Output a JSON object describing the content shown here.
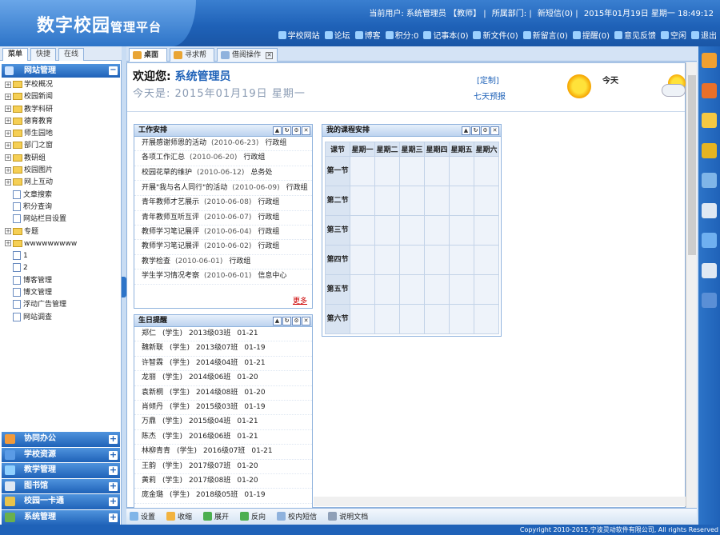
{
  "app": {
    "logo_main": "数字校园",
    "logo_sub": "管理平台"
  },
  "userline": {
    "current_user": "当前用户: 系统管理员 【教师】",
    "department": "所属部门:",
    "messages": "新短信(0)",
    "datetime": "2015年01月19日 星期一 18:49:12"
  },
  "toolbar": [
    {
      "label": "学校网站",
      "icon": "school-icon"
    },
    {
      "label": "论坛",
      "icon": "forum-icon"
    },
    {
      "label": "博客",
      "icon": "blog-icon"
    },
    {
      "label": "积分:0",
      "icon": "points-icon"
    },
    {
      "label": "记事本(0)",
      "icon": "notepad-icon"
    },
    {
      "label": "新文件(0)",
      "icon": "file-icon"
    },
    {
      "label": "新留言(0)",
      "icon": "message-icon"
    },
    {
      "label": "提醒(0)",
      "icon": "reminder-icon"
    },
    {
      "label": "意见反馈",
      "icon": "feedback-icon"
    },
    {
      "label": "空闲",
      "icon": "status-icon"
    },
    {
      "label": "退出",
      "icon": "exit-icon"
    }
  ],
  "left_tabs": [
    "菜单",
    "快捷",
    "在线"
  ],
  "nav": {
    "header": "网站管理",
    "tree": [
      {
        "label": "学校概况",
        "type": "folder"
      },
      {
        "label": "校园新闻",
        "type": "folder"
      },
      {
        "label": "教学科研",
        "type": "folder"
      },
      {
        "label": "德育教育",
        "type": "folder"
      },
      {
        "label": "师生园地",
        "type": "folder"
      },
      {
        "label": "部门之窗",
        "type": "folder"
      },
      {
        "label": "教研组",
        "type": "folder"
      },
      {
        "label": "校园图片",
        "type": "folder"
      },
      {
        "label": "网上互动",
        "type": "folder"
      },
      {
        "label": "文章搜索",
        "type": "page"
      },
      {
        "label": "积分查询",
        "type": "page"
      },
      {
        "label": "网站栏目设置",
        "type": "page"
      },
      {
        "label": "专题",
        "type": "folder"
      },
      {
        "label": "wwwwwwwww",
        "type": "folder"
      },
      {
        "label": "1",
        "type": "page"
      },
      {
        "label": "2",
        "type": "page"
      },
      {
        "label": "博客管理",
        "type": "page"
      },
      {
        "label": "博文管理",
        "type": "page"
      },
      {
        "label": "浮动广告管理",
        "type": "page"
      },
      {
        "label": "网站调查",
        "type": "page"
      }
    ],
    "sections": [
      "协同办公",
      "学校资源",
      "教学管理",
      "图书馆",
      "校园一卡通",
      "系统管理"
    ]
  },
  "tabs": [
    {
      "label": "桌面",
      "active": true
    },
    {
      "label": "寻求帮",
      "active": false
    },
    {
      "label": "借阅操作",
      "active": false
    }
  ],
  "welcome": {
    "greeting": "欢迎您:",
    "name": "系统管理员",
    "today": "今天是: 2015年01月19日 星期一",
    "customize": "[定制]",
    "forecast": "七天预报",
    "today_label": "今天"
  },
  "work_panel": {
    "title": "工作安排",
    "rows": [
      {
        "title": "开展感谢师恩的活动",
        "date": "(2010-06-23)",
        "owner": "行政组"
      },
      {
        "title": "各项工作汇总",
        "date": "(2010-06-20)",
        "owner": "行政组"
      },
      {
        "title": "校园花草的维护",
        "date": "(2010-06-12)",
        "owner": "总务处"
      },
      {
        "title": "开展\"我与名人同行\"的活动",
        "date": "(2010-06-09)",
        "owner": "行政组"
      },
      {
        "title": "青年教师才艺展示",
        "date": "(2010-06-08)",
        "owner": "行政组"
      },
      {
        "title": "青年教师互听互评",
        "date": "(2010-06-07)",
        "owner": "行政组"
      },
      {
        "title": "教师学习笔记展评",
        "date": "(2010-06-04)",
        "owner": "行政组"
      },
      {
        "title": "教师学习笔记展评",
        "date": "(2010-06-02)",
        "owner": "行政组"
      },
      {
        "title": "教学检查",
        "date": "(2010-06-01)",
        "owner": "行政组"
      },
      {
        "title": "学生学习情况考察",
        "date": "(2010-06-01)",
        "owner": "信息中心"
      }
    ],
    "more": "更多"
  },
  "birthday_panel": {
    "title": "生日提醒",
    "rows": [
      {
        "name": "郑仁",
        "role": "(学生)",
        "class": "2013级03班",
        "date": "01-21"
      },
      {
        "name": "魏新联",
        "role": "(学生)",
        "class": "2013级07班",
        "date": "01-19"
      },
      {
        "name": "许智霖",
        "role": "(学生)",
        "class": "2014级04班",
        "date": "01-21"
      },
      {
        "name": "龙丽",
        "role": "(学生)",
        "class": "2014级06班",
        "date": "01-20"
      },
      {
        "name": "袁新桐",
        "role": "(学生)",
        "class": "2014级08班",
        "date": "01-20"
      },
      {
        "name": "肖倾丹",
        "role": "(学生)",
        "class": "2015级03班",
        "date": "01-19"
      },
      {
        "name": "万鼎",
        "role": "(学生)",
        "class": "2015级04班",
        "date": "01-21"
      },
      {
        "name": "陈杰",
        "role": "(学生)",
        "class": "2016级06班",
        "date": "01-21"
      },
      {
        "name": "林柳青青",
        "role": "(学生)",
        "class": "2016级07班",
        "date": "01-21"
      },
      {
        "name": "王韵",
        "role": "(学生)",
        "class": "2017级07班",
        "date": "01-20"
      },
      {
        "name": "黄莉",
        "role": "(学生)",
        "class": "2017级08班",
        "date": "01-20"
      },
      {
        "name": "庞金璐",
        "role": "(学生)",
        "class": "2018级05班",
        "date": "01-19"
      }
    ]
  },
  "schedule_panel": {
    "title": "我的课程安排",
    "corner": "课节",
    "days": [
      "星期一",
      "星期二",
      "星期三",
      "星期四",
      "星期五",
      "星期六"
    ],
    "periods": [
      "第一节",
      "第二节",
      "第三节",
      "第四节",
      "第五节",
      "第六节"
    ]
  },
  "bottom_bar": [
    {
      "label": "设置",
      "icon": "settings-icon"
    },
    {
      "label": "收缩",
      "icon": "collapse-icon"
    },
    {
      "label": "展开",
      "icon": "expand-icon"
    },
    {
      "label": "反向",
      "icon": "reverse-icon"
    },
    {
      "label": "校内短信",
      "icon": "sms-icon"
    },
    {
      "label": "说明文档",
      "icon": "docs-icon"
    }
  ],
  "right_icons": [
    "books-icon",
    "eraser-icon",
    "pencil-icon",
    "key-icon",
    "user-icon",
    "notebook-icon",
    "download-icon",
    "printer-icon",
    "settings-gear-icon"
  ],
  "footer": "Copyright 2010-2015,宁波灵动软件有限公司, All rights Reserved"
}
